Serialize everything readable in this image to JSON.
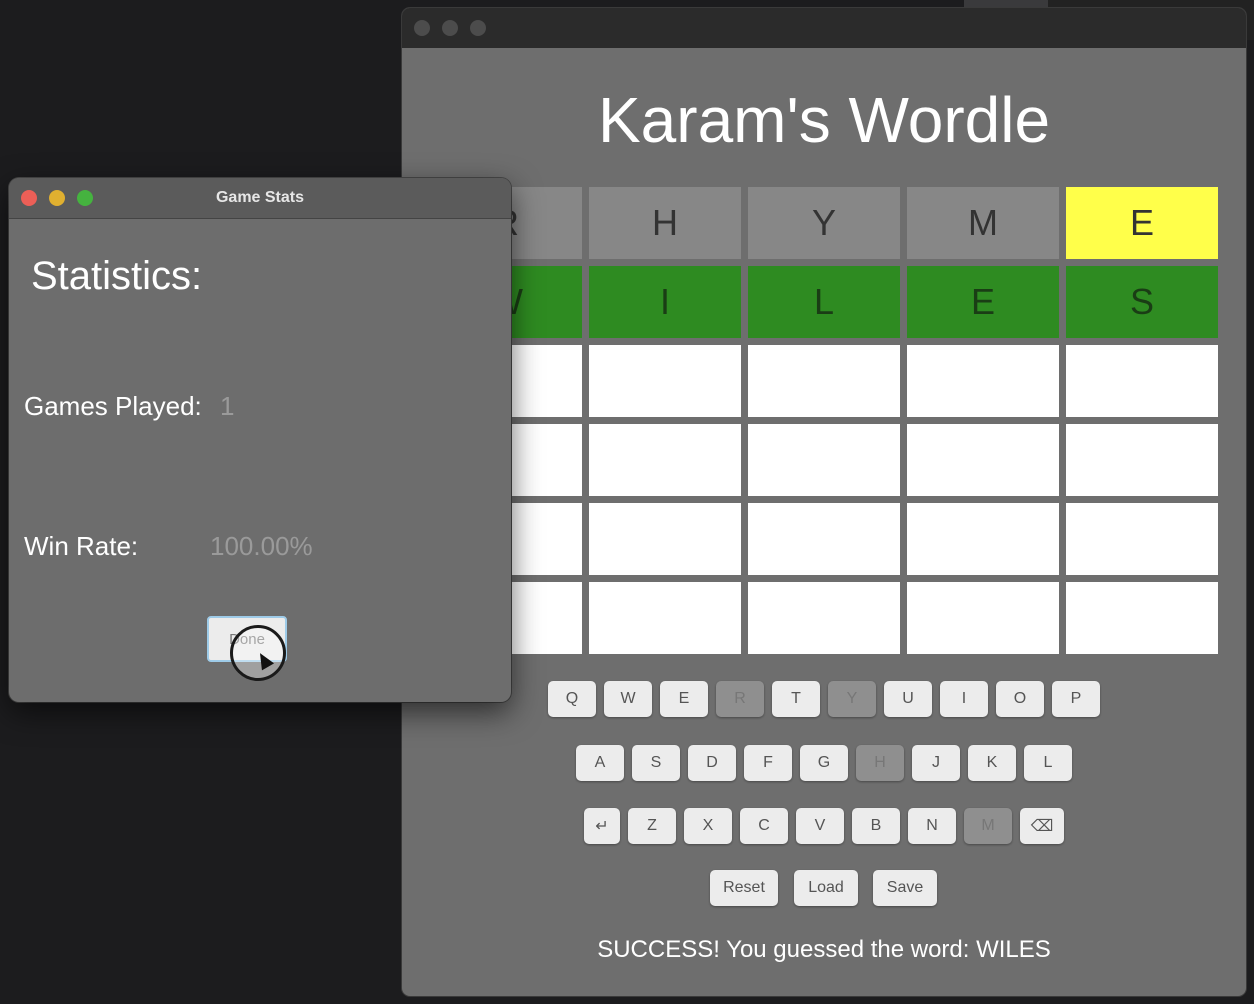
{
  "main_window": {
    "title": "Karam's Wordle",
    "status_message": "SUCCESS! You guessed the word: WILES",
    "controls": {
      "reset": "Reset",
      "load": "Load",
      "save": "Save"
    }
  },
  "board": {
    "rows": [
      [
        {
          "letter": "R",
          "state": "gray"
        },
        {
          "letter": "H",
          "state": "gray"
        },
        {
          "letter": "Y",
          "state": "gray"
        },
        {
          "letter": "M",
          "state": "gray"
        },
        {
          "letter": "E",
          "state": "yellow"
        }
      ],
      [
        {
          "letter": "W",
          "state": "green"
        },
        {
          "letter": "I",
          "state": "green"
        },
        {
          "letter": "L",
          "state": "green"
        },
        {
          "letter": "E",
          "state": "green"
        },
        {
          "letter": "S",
          "state": "green"
        }
      ],
      [
        {
          "letter": "",
          "state": "empty"
        },
        {
          "letter": "",
          "state": "empty"
        },
        {
          "letter": "",
          "state": "empty"
        },
        {
          "letter": "",
          "state": "empty"
        },
        {
          "letter": "",
          "state": "empty"
        }
      ],
      [
        {
          "letter": "",
          "state": "empty"
        },
        {
          "letter": "",
          "state": "empty"
        },
        {
          "letter": "",
          "state": "empty"
        },
        {
          "letter": "",
          "state": "empty"
        },
        {
          "letter": "",
          "state": "empty"
        }
      ],
      [
        {
          "letter": "",
          "state": "empty"
        },
        {
          "letter": "",
          "state": "empty"
        },
        {
          "letter": "",
          "state": "empty"
        },
        {
          "letter": "",
          "state": "empty"
        },
        {
          "letter": "",
          "state": "empty"
        }
      ],
      [
        {
          "letter": "",
          "state": "empty"
        },
        {
          "letter": "",
          "state": "empty"
        },
        {
          "letter": "",
          "state": "empty"
        },
        {
          "letter": "",
          "state": "empty"
        },
        {
          "letter": "",
          "state": "empty"
        }
      ]
    ]
  },
  "keyboard": {
    "rows": [
      [
        "Q",
        "W",
        "E",
        "R",
        "T",
        "Y",
        "U",
        "I",
        "O",
        "P"
      ],
      [
        "A",
        "S",
        "D",
        "F",
        "G",
        "H",
        "J",
        "K",
        "L"
      ],
      [
        "↵",
        "Z",
        "X",
        "C",
        "V",
        "B",
        "N",
        "M",
        "⌫"
      ]
    ],
    "used_keys": [
      "R",
      "Y",
      "H",
      "M"
    ]
  },
  "stats_dialog": {
    "title": "Game Stats",
    "heading": "Statistics:",
    "games_played_label": "Games Played:",
    "games_played_value": "1",
    "win_rate_label": "Win Rate:",
    "win_rate_value": "100.00%",
    "done_button": "Done"
  },
  "colors": {
    "green": "#2e8b21",
    "yellow": "#ffff4a",
    "gray_tile": "#878787",
    "traffic_red": "#ec5f57",
    "traffic_yellow": "#e0b030",
    "traffic_green": "#45b33f"
  }
}
